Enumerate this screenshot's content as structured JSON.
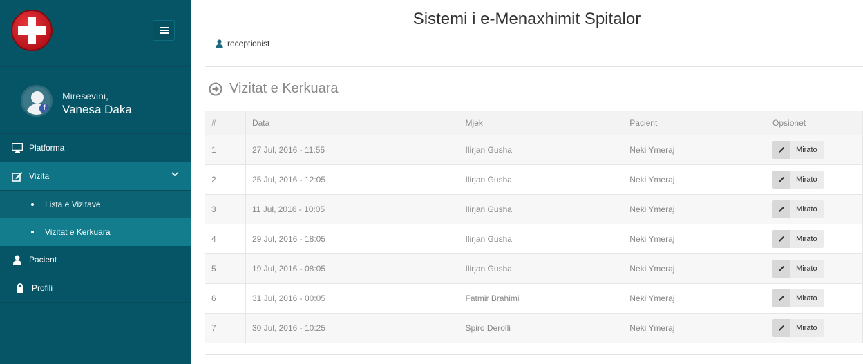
{
  "sidebar": {
    "welcome": "Miresevini,",
    "user_name": "Vanesa Daka",
    "items": [
      {
        "label": "Platforma",
        "icon": "monitor-icon"
      },
      {
        "label": "Vizita",
        "icon": "edit-icon"
      },
      {
        "label": "Pacient",
        "icon": "user-icon"
      },
      {
        "label": "Profili",
        "icon": "lock-icon"
      }
    ],
    "subitems": [
      {
        "label": "Lista e Vizitave"
      },
      {
        "label": "Vizitat e Kerkuara"
      }
    ]
  },
  "header": {
    "title": "Sistemi i e-Menaxhimit Spitalor",
    "role": "receptionist"
  },
  "section": {
    "title": "Vizitat e Kerkuara"
  },
  "table": {
    "columns": [
      "#",
      "Data",
      "Mjek",
      "Pacient",
      "Opsionet"
    ],
    "action_label": "Mirato",
    "rows": [
      {
        "num": "1",
        "date": "27 Jul, 2016 - 11:55",
        "doctor": "Ilirjan Gusha",
        "patient": "Neki Ymeraj"
      },
      {
        "num": "2",
        "date": "25 Jul, 2016 - 12:05",
        "doctor": "Ilirjan Gusha",
        "patient": "Neki Ymeraj"
      },
      {
        "num": "3",
        "date": "11 Jul, 2016 - 10:05",
        "doctor": "Ilirjan Gusha",
        "patient": "Neki Ymeraj"
      },
      {
        "num": "4",
        "date": "29 Jul, 2016 - 18:05",
        "doctor": "Ilirjan Gusha",
        "patient": "Neki Ymeraj"
      },
      {
        "num": "5",
        "date": "19 Jul, 2016 - 08:05",
        "doctor": "Ilirjan Gusha",
        "patient": "Neki Ymeraj"
      },
      {
        "num": "6",
        "date": "31 Jul, 2016 - 00:05",
        "doctor": "Fatmir Brahimi",
        "patient": "Neki Ymeraj"
      },
      {
        "num": "7",
        "date": "30 Jul, 2016 - 10:25",
        "doctor": "Spiro Derolli",
        "patient": "Neki Ymeraj"
      }
    ]
  },
  "colors": {
    "sidebar": "#065566",
    "sidebar_active": "#0f7485",
    "logo_red": "#d0222a"
  }
}
